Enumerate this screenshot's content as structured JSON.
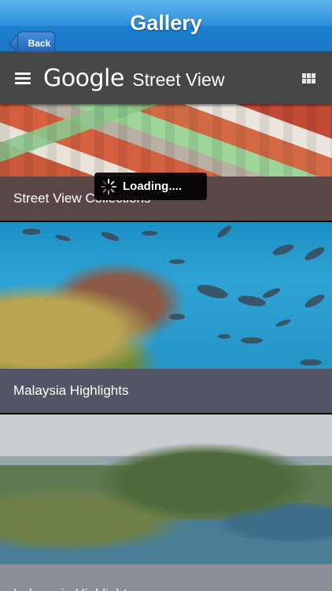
{
  "navbar": {
    "back_label": "Back",
    "title": "Gallery"
  },
  "header": {
    "brand_google": "Google",
    "brand_product": "Street View",
    "menu_icon": "hamburger-menu-icon",
    "grid_icon": "grid-view-icon"
  },
  "gallery": {
    "items": [
      {
        "label": "Street View Collections",
        "image": "aerial town rooftops"
      },
      {
        "label": "Malaysia Highlights",
        "image": "coral reef with fish"
      },
      {
        "label": "Indonesia Highlights",
        "image": "island bay landscape"
      }
    ]
  },
  "loading": {
    "text": "Loading....",
    "icon": "spinner-icon"
  },
  "colors": {
    "navbar_blue": "#2e8fd9",
    "header_gray": "#474747"
  }
}
